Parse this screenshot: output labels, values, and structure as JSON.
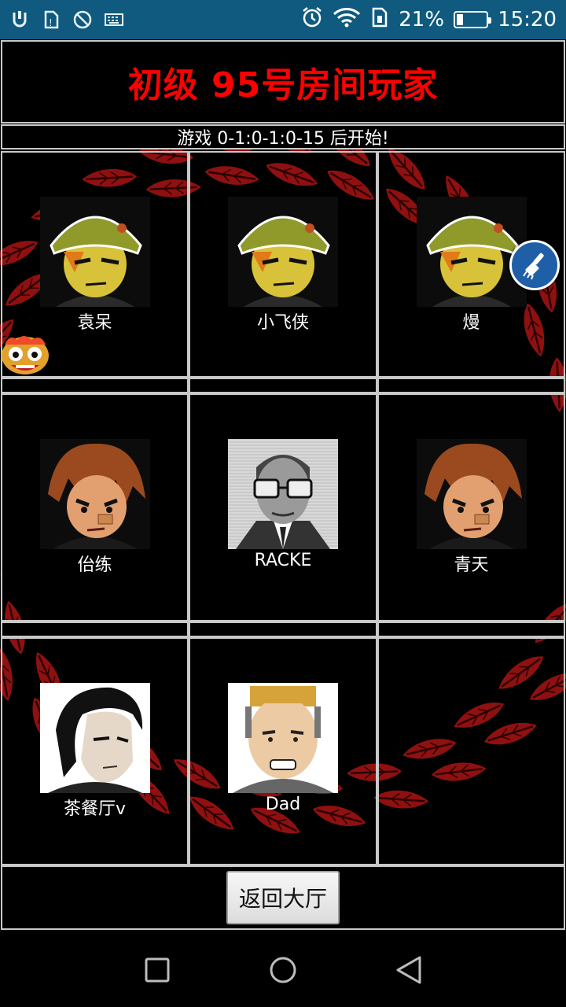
{
  "status_bar": {
    "icons_left": [
      "usb-icon",
      "sim-warning-icon",
      "blocked-icon",
      "keyboard-icon"
    ],
    "icons_right": [
      "alarm-icon",
      "wifi-icon",
      "sim-icon"
    ],
    "battery_percent": "21%",
    "battery_level": 0.21,
    "time": "15:20"
  },
  "room": {
    "title": "初级 95号房间玩家",
    "countdown": "游戏 0-1:0-1:0-15 后开始!",
    "title_color": "#ff0000"
  },
  "players": [
    {
      "name": "袁呆",
      "avatar": "soldier-avatar"
    },
    {
      "name": "小飞侠",
      "avatar": "soldier-avatar"
    },
    {
      "name": "熳",
      "avatar": "soldier-avatar"
    },
    {
      "name": "佁练",
      "avatar": "brawler-avatar"
    },
    {
      "name": "RACKE",
      "avatar": "glasses-man-avatar"
    },
    {
      "name": "青天",
      "avatar": "brawler-avatar"
    },
    {
      "name": "茶餐厅v",
      "avatar": "slick-hair-avatar"
    },
    {
      "name": "Dad",
      "avatar": "blond-man-avatar"
    }
  ],
  "back_button": "返回大厅",
  "overlays": {
    "float_button_icon": "broom-icon",
    "corner_icon": "lion-dance-icon"
  },
  "nav": [
    "recent-apps-icon",
    "home-icon",
    "back-icon"
  ]
}
